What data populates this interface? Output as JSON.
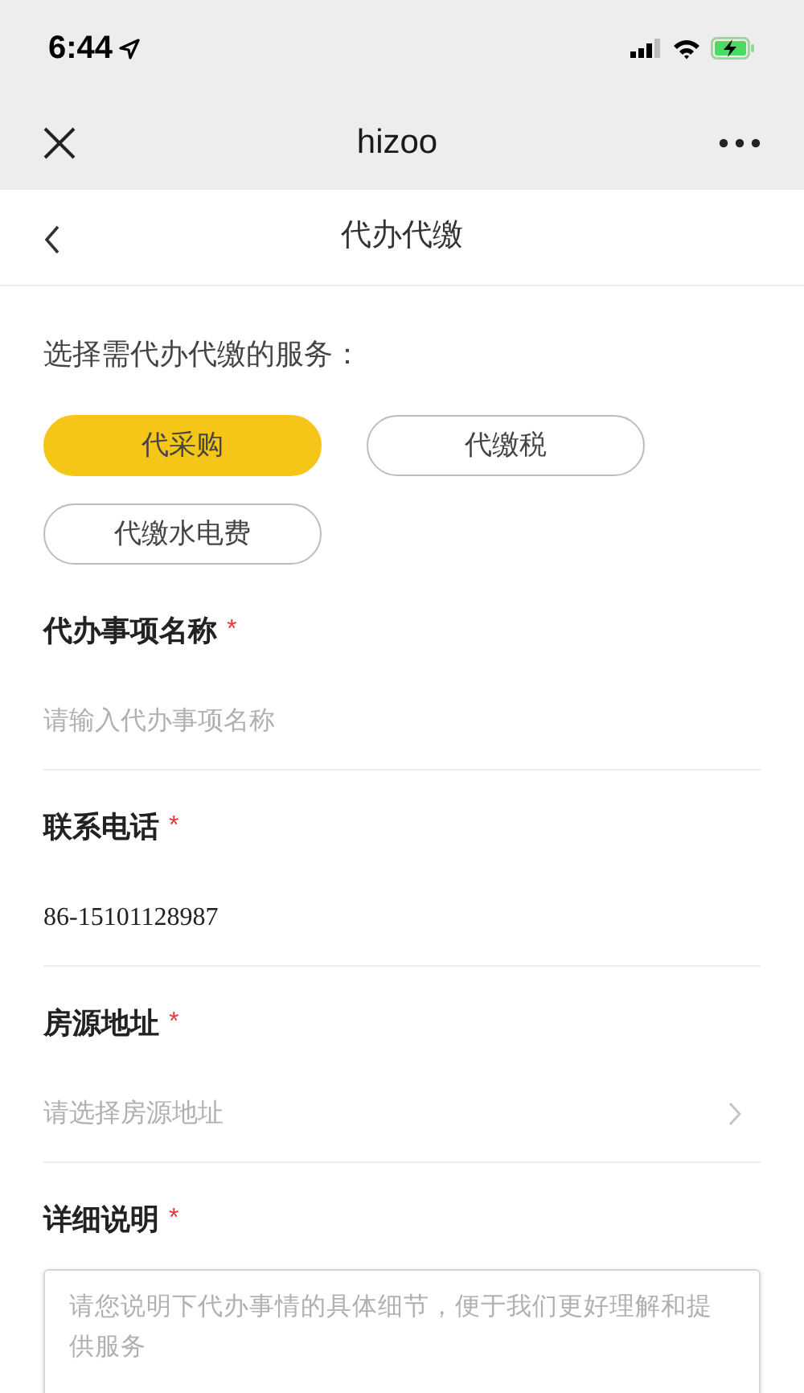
{
  "status_bar": {
    "time": "6:44"
  },
  "nav_bar": {
    "title": "hizoo"
  },
  "header": {
    "title": "代办代缴"
  },
  "service_prompt": "选择需代办代缴的服务：",
  "services": [
    {
      "label": "代采购",
      "selected": true
    },
    {
      "label": "代缴税",
      "selected": false
    },
    {
      "label": "代缴水电费",
      "selected": false
    }
  ],
  "fields": [
    {
      "kind": "input",
      "label": "代办事项名称",
      "required_mark": "*",
      "placeholder": "请输入代办事项名称"
    },
    {
      "kind": "input",
      "label": "联系电话",
      "required_mark": "*",
      "value": "86-15101128987"
    },
    {
      "kind": "select",
      "label": "房源地址",
      "required_mark": "*",
      "placeholder": "请选择房源地址"
    },
    {
      "kind": "textarea",
      "label": "详细说明",
      "required_mark": "*",
      "placeholder": "请您说明下代办事情的具体细节，便于我们更好理解和提供服务"
    }
  ]
}
